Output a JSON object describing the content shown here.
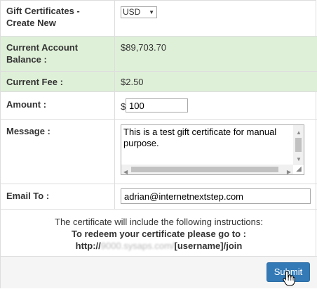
{
  "form": {
    "title_label": "Gift Certificates - Create New",
    "currency_selected": "USD",
    "balance_label": "Current Account Balance :",
    "balance_value": "$89,703.70",
    "fee_label": "Current Fee :",
    "fee_value": "$2.50",
    "amount_label": "Amount :",
    "currency_symbol": "$",
    "amount_value": "100",
    "message_label": "Message :",
    "message_value": "This is a test gift certificate for manual purpose.",
    "email_label": "Email To :",
    "email_value": "adrian@internetnextstep.com"
  },
  "instructions": {
    "note": "The certificate will include the following instructions:",
    "redeem_line": "To redeem your certificate please go to :",
    "url_prefix": "http://",
    "url_blurred": "9000.sysaps.com/",
    "url_suffix": "[username]/join"
  },
  "actions": {
    "submit_label": "Submit"
  },
  "icons": {
    "select_arrow": "dropdown-arrow-icon",
    "cursor": "hand-pointer-icon"
  },
  "colors": {
    "highlight_row": "#dff0d8",
    "primary_button": "#337ab7"
  }
}
